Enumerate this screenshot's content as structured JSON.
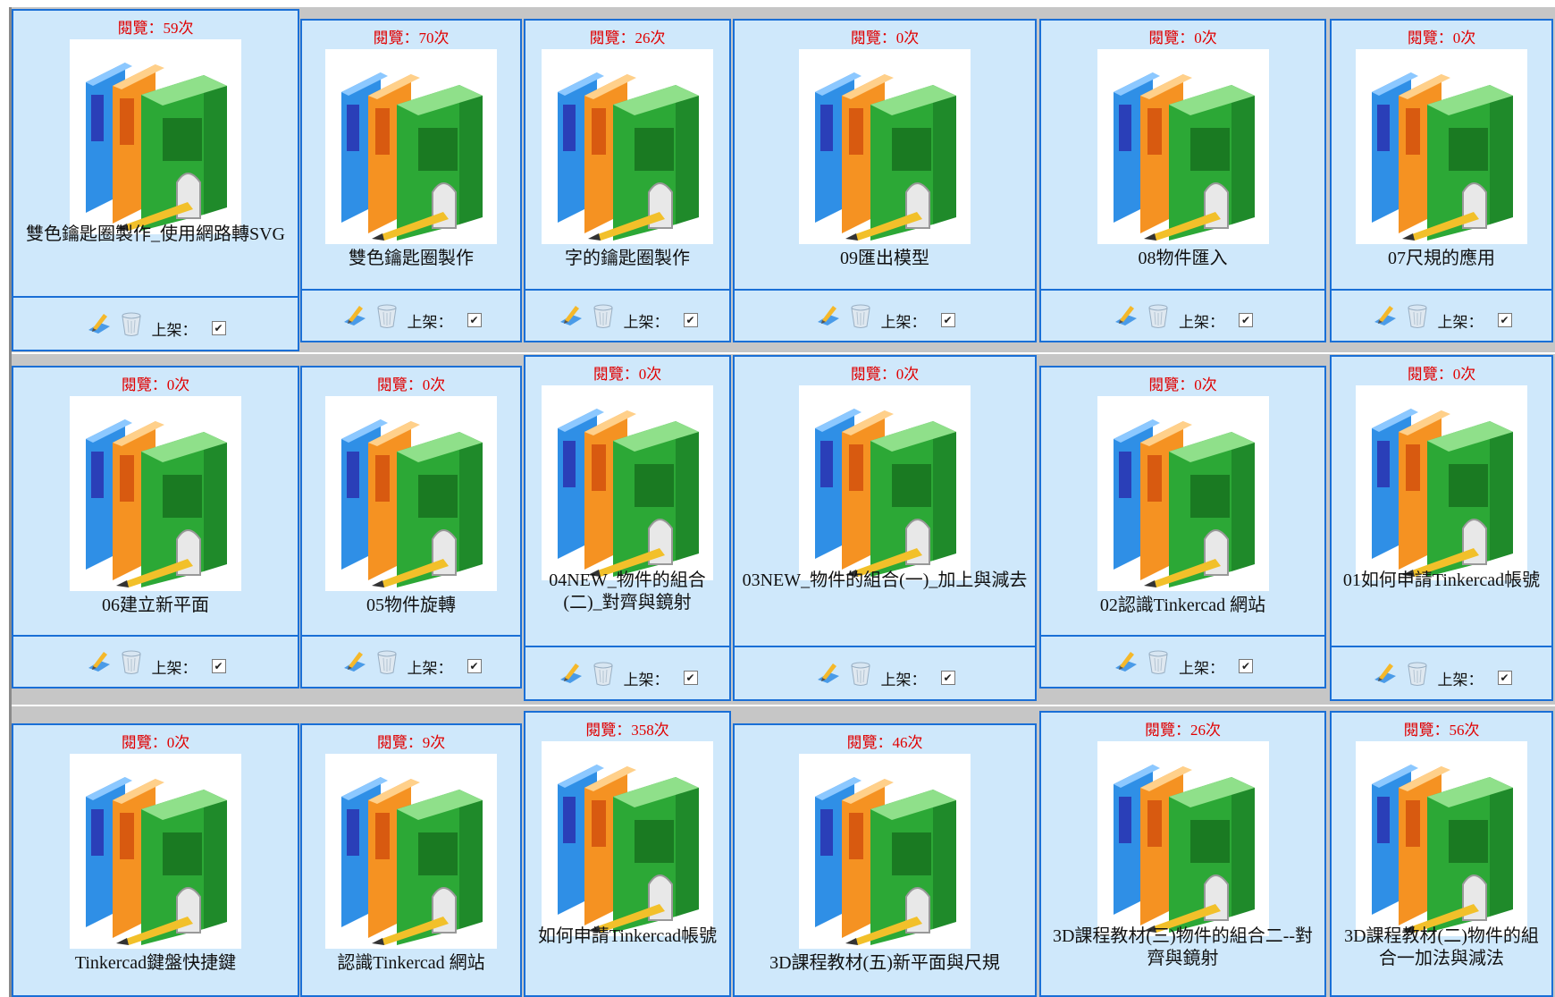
{
  "cards": [
    {
      "views": "閱覽：59次",
      "title": "雙色鑰匙圈製作_使用網路轉SVG",
      "shelf_label": "上架：",
      "published": true
    },
    {
      "views": "閱覽：70次",
      "title": "雙色鑰匙圈製作",
      "shelf_label": "上架：",
      "published": true
    },
    {
      "views": "閱覽：26次",
      "title": "字的鑰匙圈製作",
      "shelf_label": "上架：",
      "published": true
    },
    {
      "views": "閱覽：0次",
      "title": "09匯出模型",
      "shelf_label": "上架：",
      "published": true
    },
    {
      "views": "閱覽：0次",
      "title": "08物件匯入",
      "shelf_label": "上架：",
      "published": true
    },
    {
      "views": "閱覽：0次",
      "title": "07尺規的應用",
      "shelf_label": "上架：",
      "published": true
    },
    {
      "views": "閱覽：0次",
      "title": "06建立新平面",
      "shelf_label": "上架：",
      "published": true
    },
    {
      "views": "閱覽：0次",
      "title": "05物件旋轉",
      "shelf_label": "上架：",
      "published": true
    },
    {
      "views": "閱覽：0次",
      "title": "04NEW_物件的組合(二)_對齊與鏡射",
      "shelf_label": "上架：",
      "published": true
    },
    {
      "views": "閱覽：0次",
      "title": "03NEW_物件的組合(一)_加上與減去",
      "shelf_label": "上架：",
      "published": true
    },
    {
      "views": "閱覽：0次",
      "title": "02認識Tinkercad 網站",
      "shelf_label": "上架：",
      "published": true
    },
    {
      "views": "閱覽：0次",
      "title": "01如何申請Tinkercad帳號",
      "shelf_label": "上架：",
      "published": true
    },
    {
      "views": "閱覽：0次",
      "title": "Tinkercad鍵盤快捷鍵",
      "shelf_label": "上架：",
      "published": true
    },
    {
      "views": "閱覽：9次",
      "title": "認識Tinkercad 網站",
      "shelf_label": "上架：",
      "published": true
    },
    {
      "views": "閱覽：358次",
      "title": "如何申請Tinkercad帳號",
      "shelf_label": "上架：",
      "published": true
    },
    {
      "views": "閱覽：46次",
      "title": "3D課程教材(五)新平面與尺規",
      "shelf_label": "上架：",
      "published": true
    },
    {
      "views": "閱覽：26次",
      "title": "3D課程教材(三)物件的組合二--對齊與鏡射",
      "shelf_label": "上架：",
      "published": true
    },
    {
      "views": "閱覽：56次",
      "title": "3D課程教材(二)物件的組合一加法與減法",
      "shelf_label": "上架：",
      "published": true
    }
  ],
  "checkbox_mark": "✔",
  "icons": {
    "thumbnail": "book-binder-icon",
    "edit": "edit-pencil-icon",
    "delete": "trash-can-icon"
  }
}
